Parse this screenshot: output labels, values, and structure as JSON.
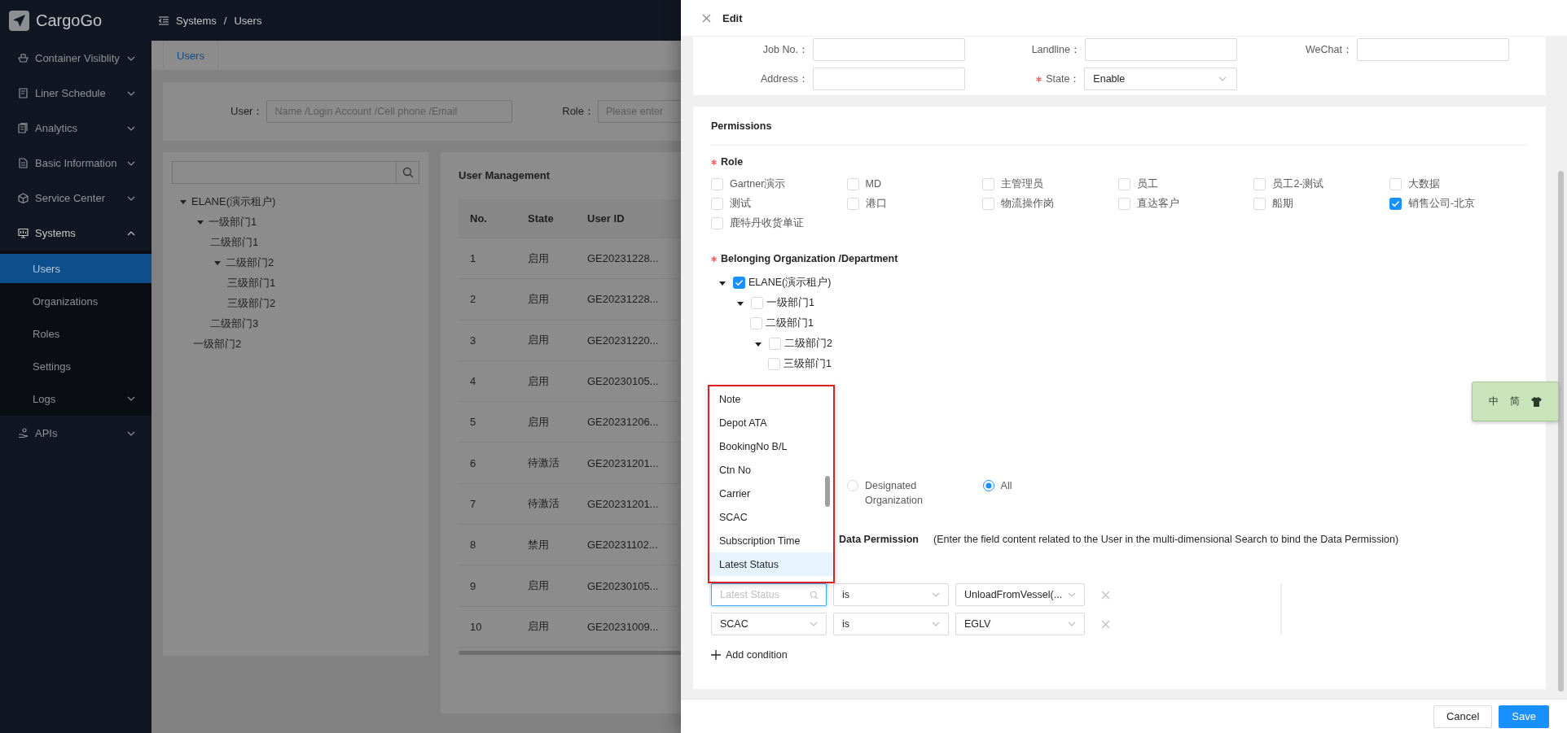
{
  "brand": {
    "name": "CargoGo"
  },
  "breadcrumb": {
    "items": [
      "Systems",
      "Users"
    ],
    "separator": "/"
  },
  "sidebar": {
    "items": [
      {
        "label": "Container Visiblity",
        "expanded": false
      },
      {
        "label": "Liner Schedule",
        "expanded": false
      },
      {
        "label": "Analytics",
        "expanded": false
      },
      {
        "label": "Basic Information",
        "expanded": false
      },
      {
        "label": "Service Center",
        "expanded": false
      },
      {
        "label": "Systems",
        "expanded": true,
        "children": [
          {
            "label": "Users",
            "selected": true
          },
          {
            "label": "Organizations",
            "selected": false
          },
          {
            "label": "Roles",
            "selected": false
          },
          {
            "label": "Settings",
            "selected": false
          },
          {
            "label": "Logs",
            "selected": false,
            "expanded": false
          }
        ]
      },
      {
        "label": "APIs",
        "expanded": false
      }
    ]
  },
  "tabs": [
    {
      "label": "Users",
      "selected": true
    }
  ],
  "filters": [
    {
      "label": "User：",
      "placeholder": "Name /Login Account /Cell phone /Email"
    },
    {
      "label": "Role：",
      "placeholder": "Please enter"
    }
  ],
  "org_tree": {
    "nodes": [
      {
        "label": "ELANE(演示租户)",
        "expanded": true,
        "children": [
          {
            "label": "一级部门1",
            "expanded": true,
            "children": [
              {
                "label": "二级部门1"
              },
              {
                "label": "二级部门2",
                "expanded": true,
                "children": [
                  {
                    "label": "三级部门1"
                  },
                  {
                    "label": "三级部门2"
                  }
                ]
              },
              {
                "label": "二级部门3"
              }
            ]
          },
          {
            "label": "一级部门2"
          }
        ]
      }
    ]
  },
  "user_table": {
    "title": "User Management",
    "columns": [
      "No.",
      "State",
      "User ID"
    ],
    "rows": [
      [
        "1",
        "启用",
        "GE20231228..."
      ],
      [
        "2",
        "启用",
        "GE20231228..."
      ],
      [
        "3",
        "启用",
        "GE20231220..."
      ],
      [
        "4",
        "启用",
        "GE20230105..."
      ],
      [
        "5",
        "启用",
        "GE20231206..."
      ],
      [
        "6",
        "待激活",
        "GE20231201..."
      ],
      [
        "7",
        "待激活",
        "GE20231201..."
      ],
      [
        "8",
        "禁用",
        "GE20231102..."
      ],
      [
        "9",
        "启用",
        "GE20230105..."
      ],
      [
        "10",
        "启用",
        "GE20231009..."
      ]
    ]
  },
  "drawer": {
    "title": "Edit",
    "profile_fields": [
      {
        "label": "Job No.：",
        "kind": "input",
        "required": false
      },
      {
        "label": "Landline：",
        "kind": "input",
        "required": false
      },
      {
        "label": "WeChat：",
        "kind": "input",
        "required": false
      },
      {
        "label": "Address：",
        "kind": "input",
        "required": false
      },
      {
        "label": "State：",
        "kind": "select",
        "required": true,
        "value": "Enable"
      }
    ],
    "permissions": {
      "title": "Permissions",
      "role": {
        "label": "Role",
        "required": true,
        "options": [
          {
            "label": "Gartner演示",
            "checked": false
          },
          {
            "label": "MD",
            "checked": false
          },
          {
            "label": "主管理员",
            "checked": false
          },
          {
            "label": "员工",
            "checked": false
          },
          {
            "label": "员工2-测试",
            "checked": false
          },
          {
            "label": "大数据",
            "checked": false
          },
          {
            "label": "测试",
            "checked": false
          },
          {
            "label": "港口",
            "checked": false
          },
          {
            "label": "物流操作岗",
            "checked": false
          },
          {
            "label": "直达客户",
            "checked": false
          },
          {
            "label": "船期",
            "checked": false
          },
          {
            "label": "销售公司-北京",
            "checked": true
          },
          {
            "label": "鹿特丹收货单证",
            "checked": false
          }
        ]
      },
      "organization": {
        "label": "Belonging Organization /Department",
        "required": true,
        "nodes": [
          {
            "label": "ELANE(演示租户)",
            "checked": true,
            "expanded": true,
            "children": [
              {
                "label": "一级部门1",
                "checked": false,
                "expanded": true,
                "children": [
                  {
                    "label": "二级部门1",
                    "checked": false
                  },
                  {
                    "label": "二级部门2",
                    "checked": false,
                    "expanded": true,
                    "children": [
                      {
                        "label": "三级部门1",
                        "checked": false
                      }
                    ]
                  }
                ]
              }
            ]
          }
        ]
      },
      "scope_options": [
        {
          "label": "Designated Organization",
          "selected": false
        },
        {
          "label": "All",
          "selected": true
        }
      ],
      "data_permission": {
        "label": "Data Permission",
        "hint": "(Enter the field content related to the User in the multi-dimensional Search to bind the Data Permission)",
        "conditions": [
          {
            "field": {
              "placeholder": "Latest Status",
              "focused": true
            },
            "operator": "is",
            "value": "UnloadFromVessel(..."
          },
          {
            "field": {
              "value": "SCAC",
              "focused": false
            },
            "operator": "is",
            "value": "EGLV"
          }
        ],
        "add_label": "Add condition"
      }
    },
    "field_dropdown": {
      "items": [
        {
          "label": "Note",
          "selected": false
        },
        {
          "label": "Depot ATA",
          "selected": false
        },
        {
          "label": "BookingNo B/L",
          "selected": false
        },
        {
          "label": "Ctn No",
          "selected": false
        },
        {
          "label": "Carrier",
          "selected": false
        },
        {
          "label": "SCAC",
          "selected": false
        },
        {
          "label": "Subscription Time",
          "selected": false
        },
        {
          "label": "Latest Status",
          "selected": true
        }
      ]
    },
    "buttons": [
      {
        "label": "Cancel",
        "kind": "default"
      },
      {
        "label": "Save",
        "kind": "primary"
      }
    ]
  },
  "input_method": {
    "labels": [
      "中",
      "简"
    ]
  }
}
